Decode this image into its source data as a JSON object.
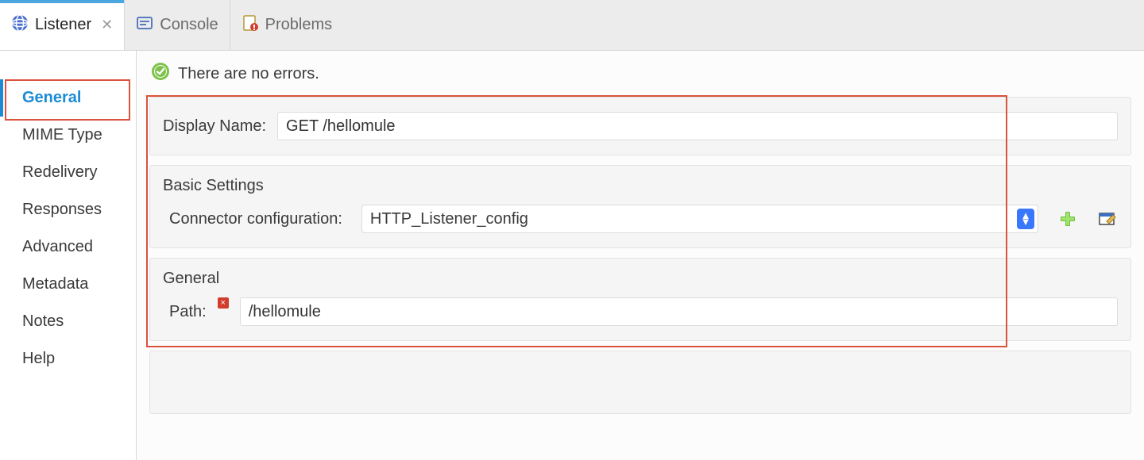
{
  "tabs": [
    {
      "label": "Listener",
      "active": true,
      "closable": true,
      "icon": "globe"
    },
    {
      "label": "Console",
      "active": false,
      "closable": false,
      "icon": "console"
    },
    {
      "label": "Problems",
      "active": false,
      "closable": false,
      "icon": "problems"
    }
  ],
  "sidebar": {
    "items": [
      {
        "label": "General",
        "selected": true
      },
      {
        "label": "MIME Type",
        "selected": false
      },
      {
        "label": "Redelivery",
        "selected": false
      },
      {
        "label": "Responses",
        "selected": false
      },
      {
        "label": "Advanced",
        "selected": false
      },
      {
        "label": "Metadata",
        "selected": false
      },
      {
        "label": "Notes",
        "selected": false
      },
      {
        "label": "Help",
        "selected": false
      }
    ]
  },
  "status": {
    "text": "There are no errors."
  },
  "display_name": {
    "label": "Display Name:",
    "value": "GET /hellomule"
  },
  "basic_settings": {
    "heading": "Basic Settings",
    "connector_label": "Connector configuration:",
    "connector_value": "HTTP_Listener_config"
  },
  "general": {
    "heading": "General",
    "path_label": "Path:",
    "path_value": "/hellomule"
  }
}
